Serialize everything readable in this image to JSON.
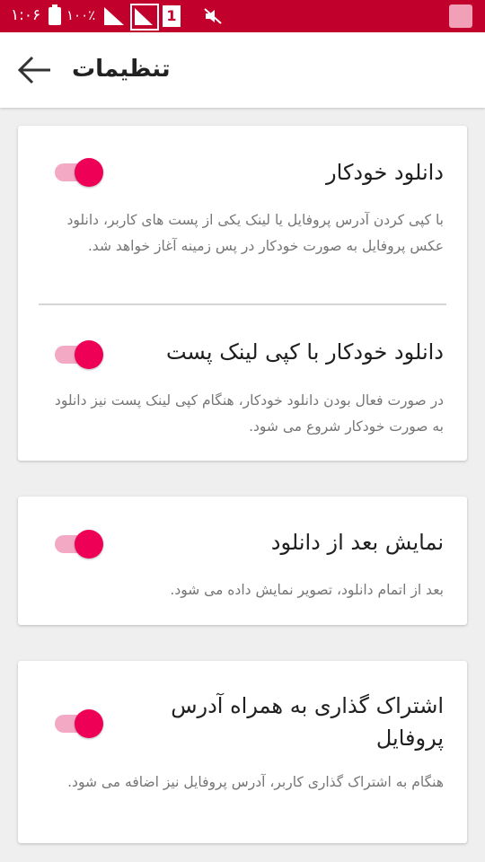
{
  "status_bar": {
    "time": "۱:۰۶",
    "battery": "۱۰۰٪",
    "sim_label": "1"
  },
  "app_bar": {
    "title": "تنظیمات"
  },
  "settings": [
    {
      "title": "دانلود خودکار",
      "description": "با کپی کردن آدرس پروفایل یا لینک یکی از پست های کاربر، دانلود عکس پروفایل به صورت خودکار در پس زمینه آغاز خواهد شد.",
      "enabled": true
    },
    {
      "title": "دانلود خودکار با کپی لینک پست",
      "description": "در صورت فعال بودن دانلود خودکار، هنگام کپی لینک پست نیز دانلود به صورت خودکار شروع می شود.",
      "enabled": true
    },
    {
      "title": "نمایش بعد از دانلود",
      "description": "بعد از اتمام دانلود، تصویر نمایش داده می شود.",
      "enabled": true
    },
    {
      "title": "اشتراک گذاری به همراه آدرس پروفایل",
      "description": "هنگام به اشتراک گذاری کاربر، آدرس پروفایل نیز اضافه می شود.",
      "enabled": true
    }
  ],
  "colors": {
    "status_bar": "#c2002c",
    "accent": "#ee0056",
    "toggle_track": "#f3a8c4"
  }
}
